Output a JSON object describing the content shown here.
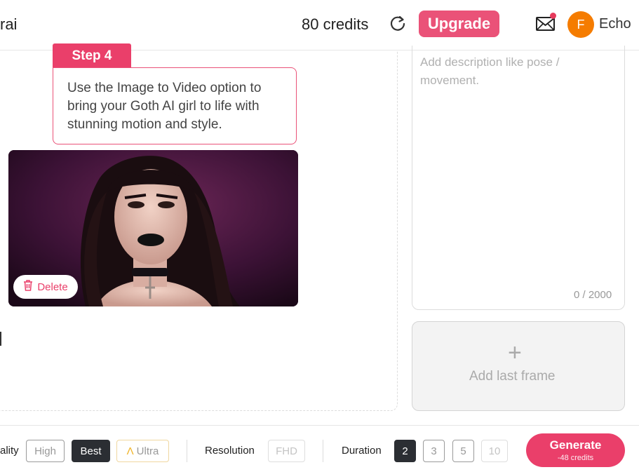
{
  "header": {
    "brand": "rai",
    "credits": "80 credits",
    "upgrade_label": "Upgrade",
    "avatar_initial": "F",
    "username": "Echo"
  },
  "tutorial": {
    "step_label": "Step 4",
    "step_text": "Use the Image to Video option to bring your Goth AI girl to life with stunning motion and style."
  },
  "image_card": {
    "delete_label": "Delete"
  },
  "description": {
    "placeholder": "Add description like pose / movement.",
    "char_count": "0 / 2000"
  },
  "last_frame": {
    "label": "Add last frame"
  },
  "settings": {
    "quality_label": "ality",
    "quality_options": [
      "High",
      "Best",
      "Ultra"
    ],
    "quality_selected": "Best",
    "resolution_label": "Resolution",
    "resolution_value": "FHD",
    "duration_label": "Duration",
    "duration_options": [
      "2",
      "3",
      "5",
      "10"
    ],
    "duration_selected": "2"
  },
  "generate": {
    "label": "Generate",
    "cost": "-48 credits"
  },
  "colors": {
    "accent": "#ea3f6a",
    "avatar": "#f57c00",
    "active_option": "#2b2e33"
  }
}
